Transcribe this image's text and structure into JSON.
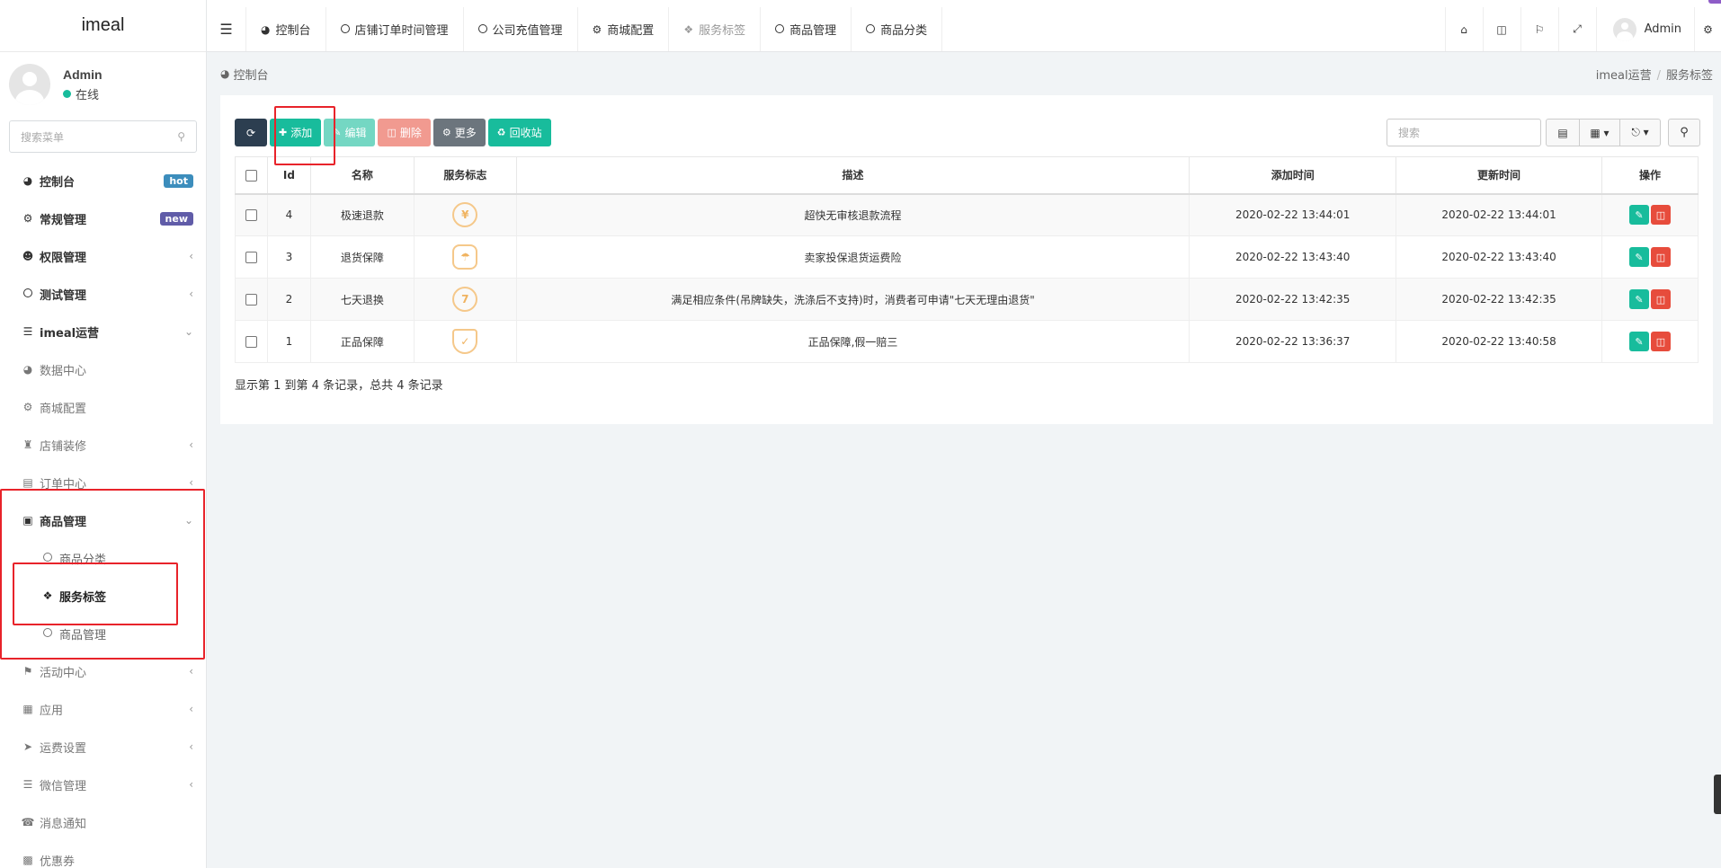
{
  "app": {
    "logo": "imeal"
  },
  "user": {
    "name": "Admin",
    "status": "在线"
  },
  "sidebar": {
    "search_placeholder": "搜索菜单",
    "items": [
      {
        "label": "控制台",
        "badge": "hot",
        "badge_color": "#3c8dbc"
      },
      {
        "label": "常规管理",
        "badge": "new",
        "badge_color": "#605ca8"
      },
      {
        "label": "权限管理"
      },
      {
        "label": "测试管理"
      },
      {
        "label": "imeal运营"
      },
      {
        "label": "数据中心"
      },
      {
        "label": "商城配置"
      },
      {
        "label": "店铺装修"
      },
      {
        "label": "订单中心"
      },
      {
        "label": "商品管理"
      },
      {
        "label": "商品分类"
      },
      {
        "label": "服务标签"
      },
      {
        "label": "商品管理"
      },
      {
        "label": "活动中心"
      },
      {
        "label": "应用"
      },
      {
        "label": "运费设置"
      },
      {
        "label": "微信管理"
      },
      {
        "label": "消息通知"
      },
      {
        "label": "优惠券"
      }
    ]
  },
  "topnav": {
    "tabs": [
      "控制台",
      "店铺订单时间管理",
      "公司充值管理",
      "商城配置",
      "服务标签",
      "商品管理",
      "商品分类"
    ],
    "user": "Admin"
  },
  "breadcrumb": {
    "left": "控制台",
    "path": [
      "imeal运营",
      "服务标签"
    ]
  },
  "toolbar": {
    "add": "添加",
    "edit": "编辑",
    "delete": "删除",
    "more": "更多",
    "recycle": "回收站",
    "search_placeholder": "搜索"
  },
  "table": {
    "headers": [
      "Id",
      "名称",
      "服务标志",
      "描述",
      "添加时间",
      "更新时间",
      "操作"
    ],
    "rows": [
      {
        "id": "4",
        "name": "极速退款",
        "icon": "yen-circle-icon",
        "glyph": "¥",
        "desc": "超快无审核退款流程",
        "created": "2020-02-22 13:44:01",
        "updated": "2020-02-22 13:44:01"
      },
      {
        "id": "3",
        "name": "退货保障",
        "icon": "umbrella-hexagon-icon",
        "glyph": "☂",
        "desc": "卖家投保退货运费险",
        "created": "2020-02-22 13:43:40",
        "updated": "2020-02-22 13:43:40"
      },
      {
        "id": "2",
        "name": "七天退换",
        "icon": "seven-days-icon",
        "glyph": "7",
        "desc": "满足相应条件(吊牌缺失，洗涤后不支持)时，消费者可申请\"七天无理由退货\"",
        "created": "2020-02-22 13:42:35",
        "updated": "2020-02-22 13:42:35"
      },
      {
        "id": "1",
        "name": "正品保障",
        "icon": "shield-check-icon",
        "glyph": "✓",
        "desc": "正品保障,假一赔三",
        "created": "2020-02-22 13:36:37",
        "updated": "2020-02-22 13:40:58"
      }
    ]
  },
  "pager": {
    "info": "显示第 1 到第 4 条记录，总共 4 条记录"
  }
}
